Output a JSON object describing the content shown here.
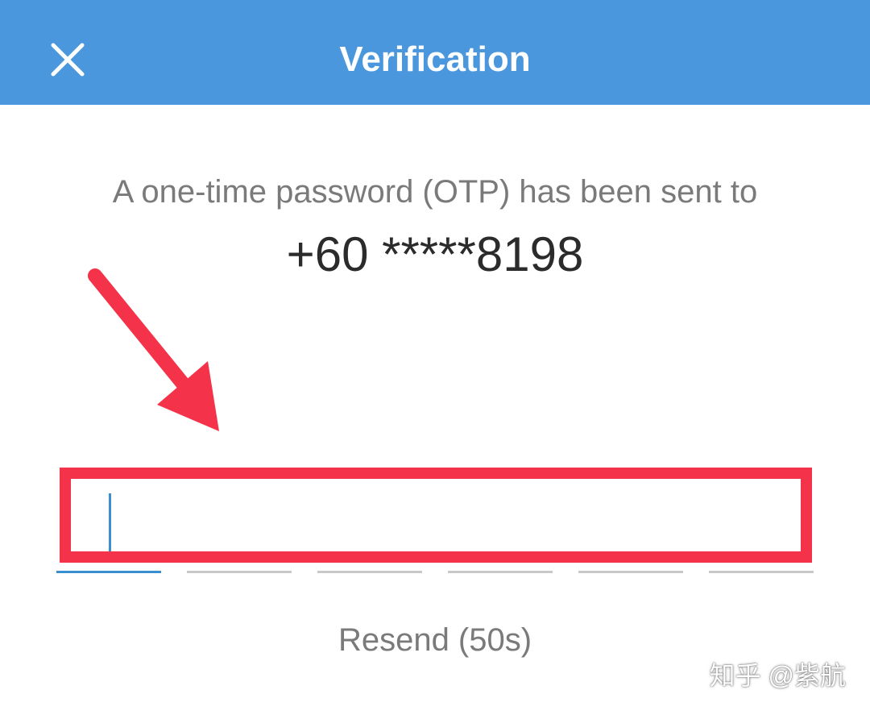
{
  "header": {
    "title": "Verification",
    "close_icon": "close-icon",
    "background_color": "#4a97dd"
  },
  "message": {
    "text": "A one-time password (OTP) has been sent to",
    "phone": "+60 *****8198"
  },
  "otp": {
    "value": "",
    "digit_count": 6,
    "active_index": 0,
    "highlight_color": "#f4334a",
    "active_color": "#3a8fd0"
  },
  "resend": {
    "label": "Resend (50s)"
  },
  "annotation": {
    "arrow_icon": "red-arrow-icon"
  },
  "watermark": {
    "text": "知乎 @紫航"
  }
}
